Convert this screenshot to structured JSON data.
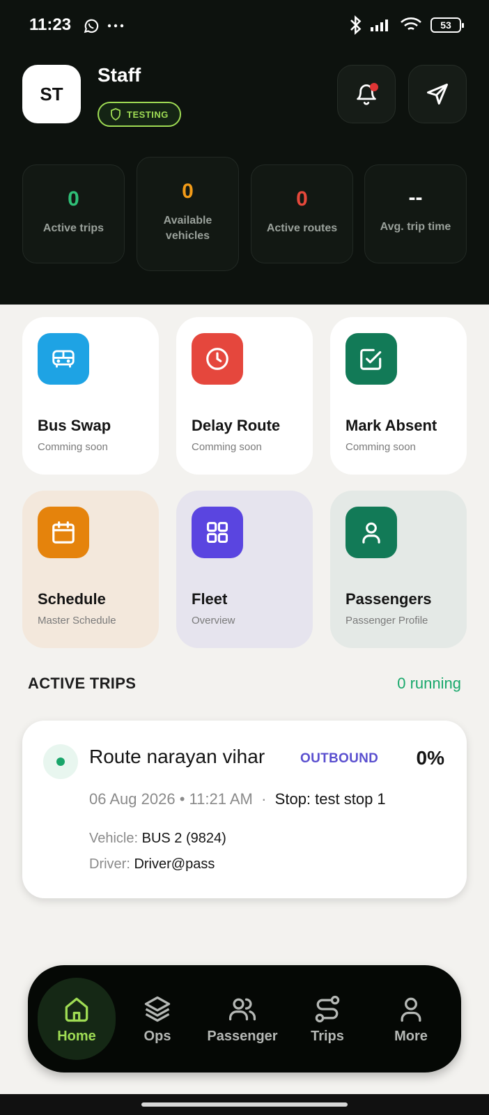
{
  "status_bar": {
    "time": "11:23",
    "battery": "53"
  },
  "header": {
    "avatar_initials": "ST",
    "user_name": "Staff",
    "role_badge": "TESTING",
    "notification_has_unread": true
  },
  "stats": [
    {
      "value": "0",
      "label": "Active trips",
      "color": "#2fbf77"
    },
    {
      "value": "0",
      "label": "Available vehicles",
      "color": "#f29b18"
    },
    {
      "value": "0",
      "label": "Active routes",
      "color": "#e5483b"
    },
    {
      "value": "--",
      "label": "Avg. trip time",
      "color": "#ffffff"
    }
  ],
  "actions": [
    {
      "title": "Bus Swap",
      "subtitle": "Comming soon",
      "icon": "bus-icon",
      "icon_color": "#1ea3e4"
    },
    {
      "title": "Delay Route",
      "subtitle": "Comming soon",
      "icon": "clock-icon",
      "icon_color": "#e5473d"
    },
    {
      "title": "Mark Absent",
      "subtitle": "Comming soon",
      "icon": "check-square-icon",
      "icon_color": "#127a57"
    },
    {
      "title": "Schedule",
      "subtitle": "Master Schedule",
      "icon": "calendar-icon",
      "icon_color": "#e5830c"
    },
    {
      "title": "Fleet",
      "subtitle": "Overview",
      "icon": "grid-icon",
      "icon_color": "#5a45e0"
    },
    {
      "title": "Passengers",
      "subtitle": "Passenger Profile",
      "icon": "user-icon",
      "icon_color": "#127a57"
    }
  ],
  "active_trips": {
    "title": "ACTIVE TRIPS",
    "count_label": "0 running",
    "trip": {
      "route": "Route narayan vihar",
      "direction": "OUTBOUND",
      "progress": "0%",
      "date": "06 Aug 2026",
      "time": "11:21 AM",
      "stop": "Stop: test stop 1",
      "vehicle_label": "Vehicle:",
      "vehicle_value": "BUS 2 (9824)",
      "driver_label": "Driver:",
      "driver_value": "Driver@pass"
    }
  },
  "bottom_nav": [
    {
      "label": "Home",
      "icon": "home-icon",
      "active": true
    },
    {
      "label": "Ops",
      "icon": "layers-icon",
      "active": false
    },
    {
      "label": "Passenger",
      "icon": "users-icon",
      "active": false
    },
    {
      "label": "Trips",
      "icon": "route-icon",
      "active": false
    },
    {
      "label": "More",
      "icon": "user-icon",
      "active": false
    }
  ]
}
